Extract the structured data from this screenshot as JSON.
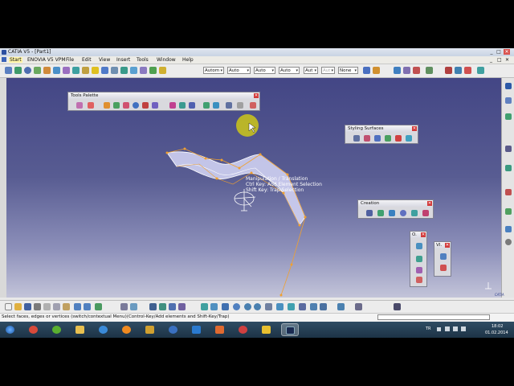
{
  "window": {
    "title": "CATIA V5 - [Part1]",
    "controls": [
      "_",
      "□",
      "✕"
    ]
  },
  "menubar": {
    "items": [
      "Start",
      "ENOVIA V5 VPM",
      "File",
      "Edit",
      "View",
      "Insert",
      "Tools",
      "Window",
      "Help"
    ],
    "doc_controls": [
      "_",
      "□",
      "✕"
    ]
  },
  "toolbar": {
    "combos": [
      {
        "value": "Autom",
        "disabled": false
      },
      {
        "value": "Auto",
        "disabled": false
      },
      {
        "value": "Auto",
        "disabled": false
      },
      {
        "value": "Auto",
        "disabled": false
      },
      {
        "value": "Aut",
        "disabled": false
      },
      {
        "value": "Aut",
        "disabled": true
      },
      {
        "value": "None",
        "disabled": false
      }
    ]
  },
  "palettes": {
    "tools_palette": {
      "title": "Tools Palette"
    },
    "styling_surfaces": {
      "title": "Styling Surfaces"
    },
    "creation": {
      "title": "Creation"
    },
    "small_1": {
      "title": "O."
    },
    "small_2": {
      "title": "VI."
    }
  },
  "tooltip": {
    "line1": "Manipulation / Translation",
    "line2": "Ctrl Key: Add Element Selection",
    "line3": "Shift Key: Trap Selection"
  },
  "status": {
    "text": "Select faces, edges or vertices (switch/contextual Menu)(Control-Key/Add elements and Shift-Key/Trap)"
  },
  "brand": "CATIA",
  "taskbar": {
    "language": "TR",
    "time": "18:02",
    "date": "01.02.2014"
  },
  "colors": {
    "viewport_top": "#434685",
    "viewport_bottom": "#c3c4d9",
    "surface_fill": "#c8c9ee",
    "control_points": "#f0a030",
    "tooltip_highlight": "#e8e000",
    "taskbar": "#2f4c63"
  }
}
